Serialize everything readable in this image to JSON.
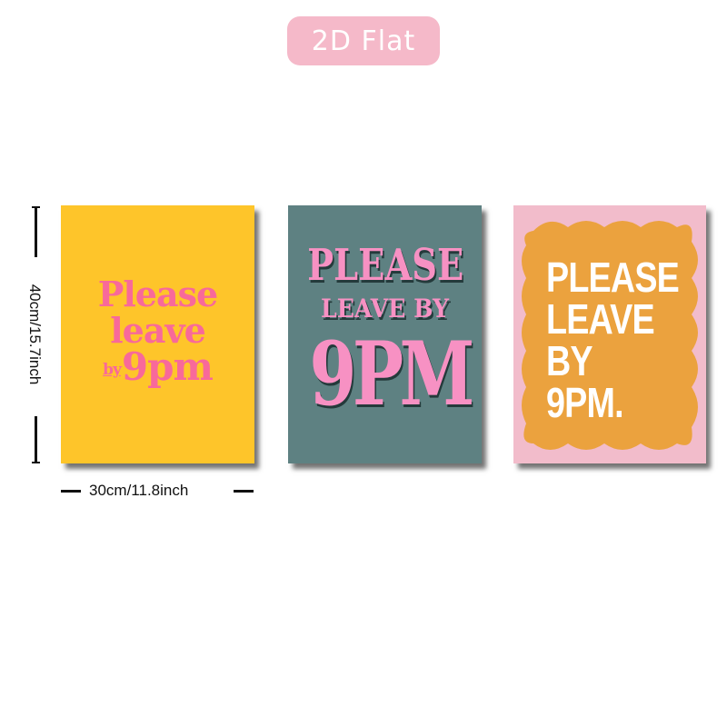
{
  "badge": {
    "label": "2D Flat"
  },
  "dimensions": {
    "height_label": "40cm/15.7inch",
    "width_label": "30cm/11.8inch"
  },
  "posters": [
    {
      "background": "#fec52a",
      "text_color": "#f8699a",
      "line1": "Please",
      "line2": "leave",
      "line3_small": "by",
      "line3_big": "9pm"
    },
    {
      "background": "#5e8182",
      "text_color": "#f791c3",
      "line1": "PLEASE",
      "line2": "LEAVE BY",
      "line3": "9PM"
    },
    {
      "background": "#f2bccb",
      "shape_color": "#eba23e",
      "text_color": "#ffffff",
      "line1": "PLEASE",
      "line2": "LEAVE",
      "line3": "BY",
      "line4": "9PM."
    }
  ]
}
